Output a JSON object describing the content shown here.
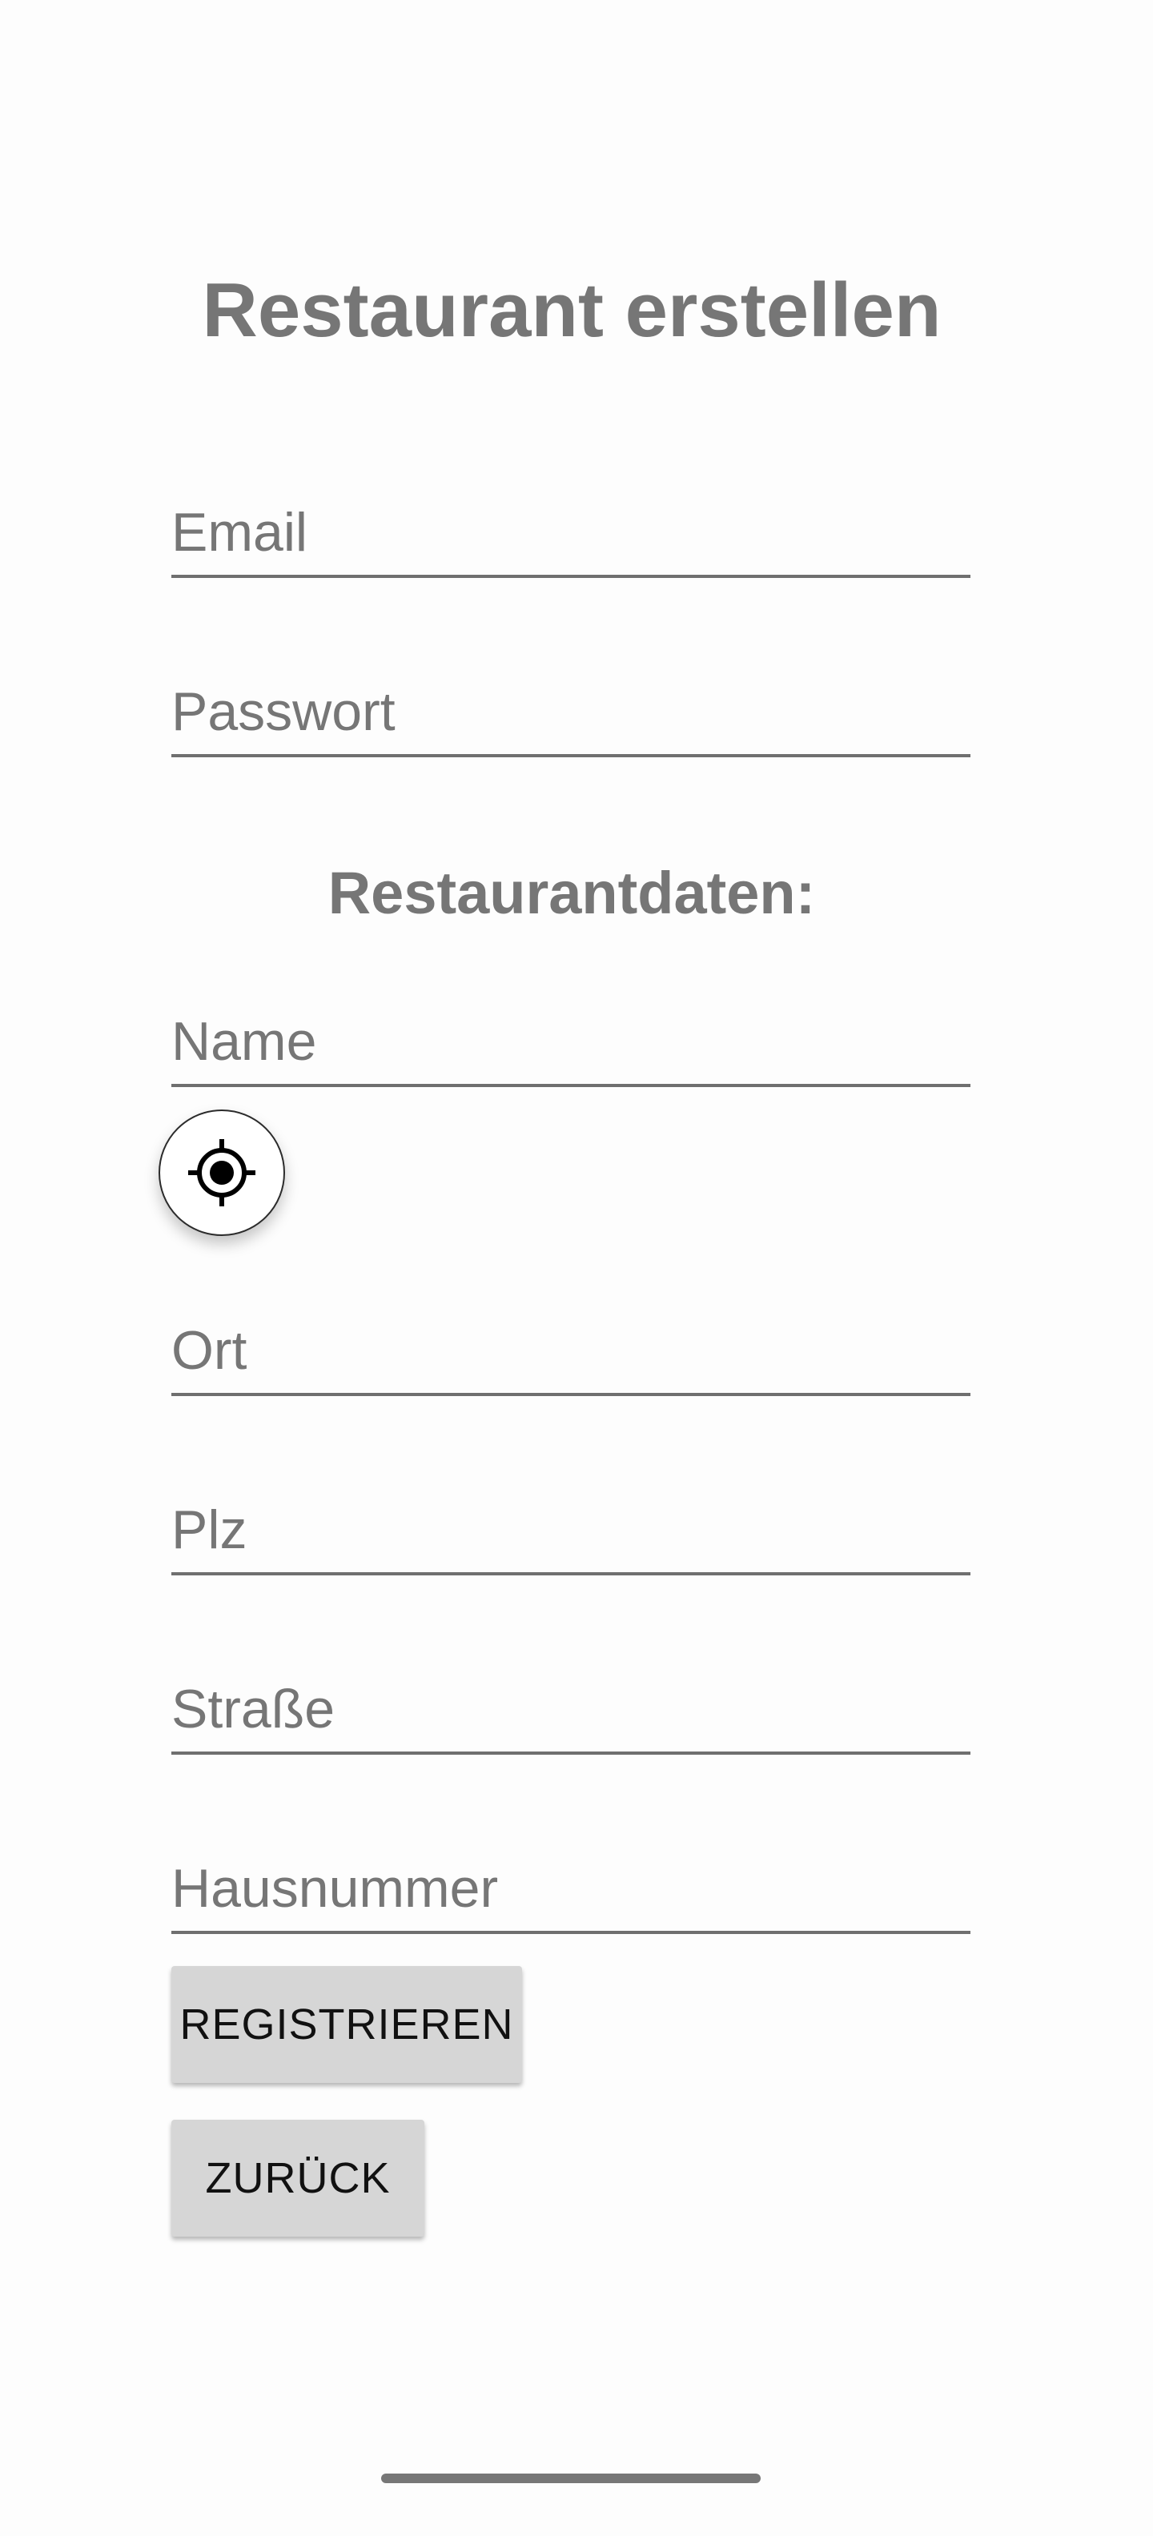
{
  "page": {
    "title": "Restaurant erstellen"
  },
  "account": {
    "email_placeholder": "Email",
    "password_placeholder": "Passwort"
  },
  "restaurant": {
    "section_title": "Restaurantdaten:",
    "name_placeholder": "Name",
    "location_icon": "gps-crosshair-icon",
    "city_placeholder": "Ort",
    "zip_placeholder": "Plz",
    "street_placeholder": "Straße",
    "house_number_placeholder": "Hausnummer"
  },
  "actions": {
    "register_label": "REGISTRIEREN",
    "back_label": "ZURÜCK"
  },
  "colors": {
    "heading": "#767676",
    "underline": "#6f6f6f",
    "button_bg": "#d6d6d6",
    "background": "#fdfdfd"
  }
}
